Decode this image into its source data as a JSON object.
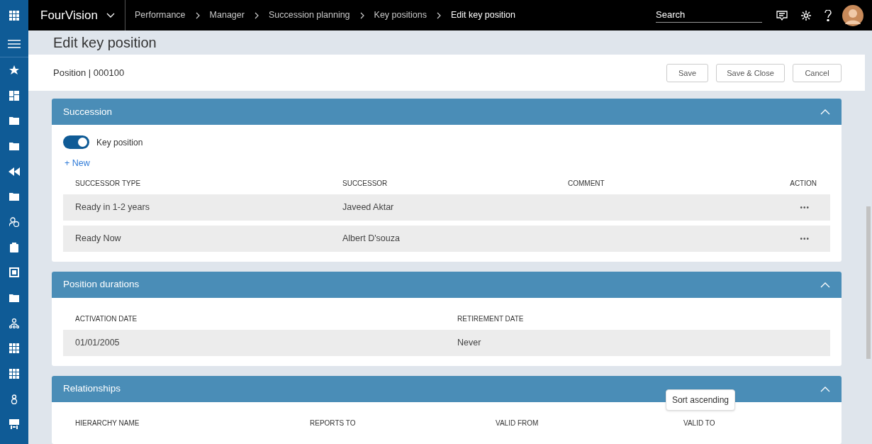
{
  "app": {
    "name": "FourVision"
  },
  "breadcrumb": [
    {
      "label": "Performance",
      "current": false
    },
    {
      "label": "Manager",
      "current": false
    },
    {
      "label": "Succession planning",
      "current": false
    },
    {
      "label": "Key positions",
      "current": false
    },
    {
      "label": "Edit key position",
      "current": true
    }
  ],
  "search": {
    "placeholder": "Search"
  },
  "page_title": "Edit key position",
  "record": "Position | 000100",
  "buttons": [
    "Save",
    "Save & Close",
    "Cancel"
  ],
  "sections": [
    {
      "title": "Succession",
      "expanded": true,
      "toggle": {
        "label": "Key position",
        "on": true
      },
      "new_link": "+ New",
      "columns": [
        "SUCCESSOR TYPE",
        "SUCCESSOR",
        "COMMENT",
        "ACTION"
      ],
      "rows": [
        {
          "cells": [
            "Ready in 1-2 years",
            "Javeed Aktar"
          ],
          "action": "•••"
        },
        {
          "cells": [
            "Ready Now",
            "Albert D'souza"
          ],
          "action": "•••"
        }
      ]
    },
    {
      "title": "Position durations",
      "expanded": true,
      "columns": [
        "ACTIVATION DATE",
        "RETIREMENT DATE"
      ],
      "rows": [
        {
          "cells": [
            "01/01/2005",
            "Never"
          ]
        }
      ]
    },
    {
      "title": "Relationships",
      "expanded": true,
      "columns": [
        "HIERARCHY NAME",
        "REPORTS TO",
        "VALID FROM",
        "VALID TO"
      ]
    }
  ],
  "tooltip": "Sort ascending"
}
